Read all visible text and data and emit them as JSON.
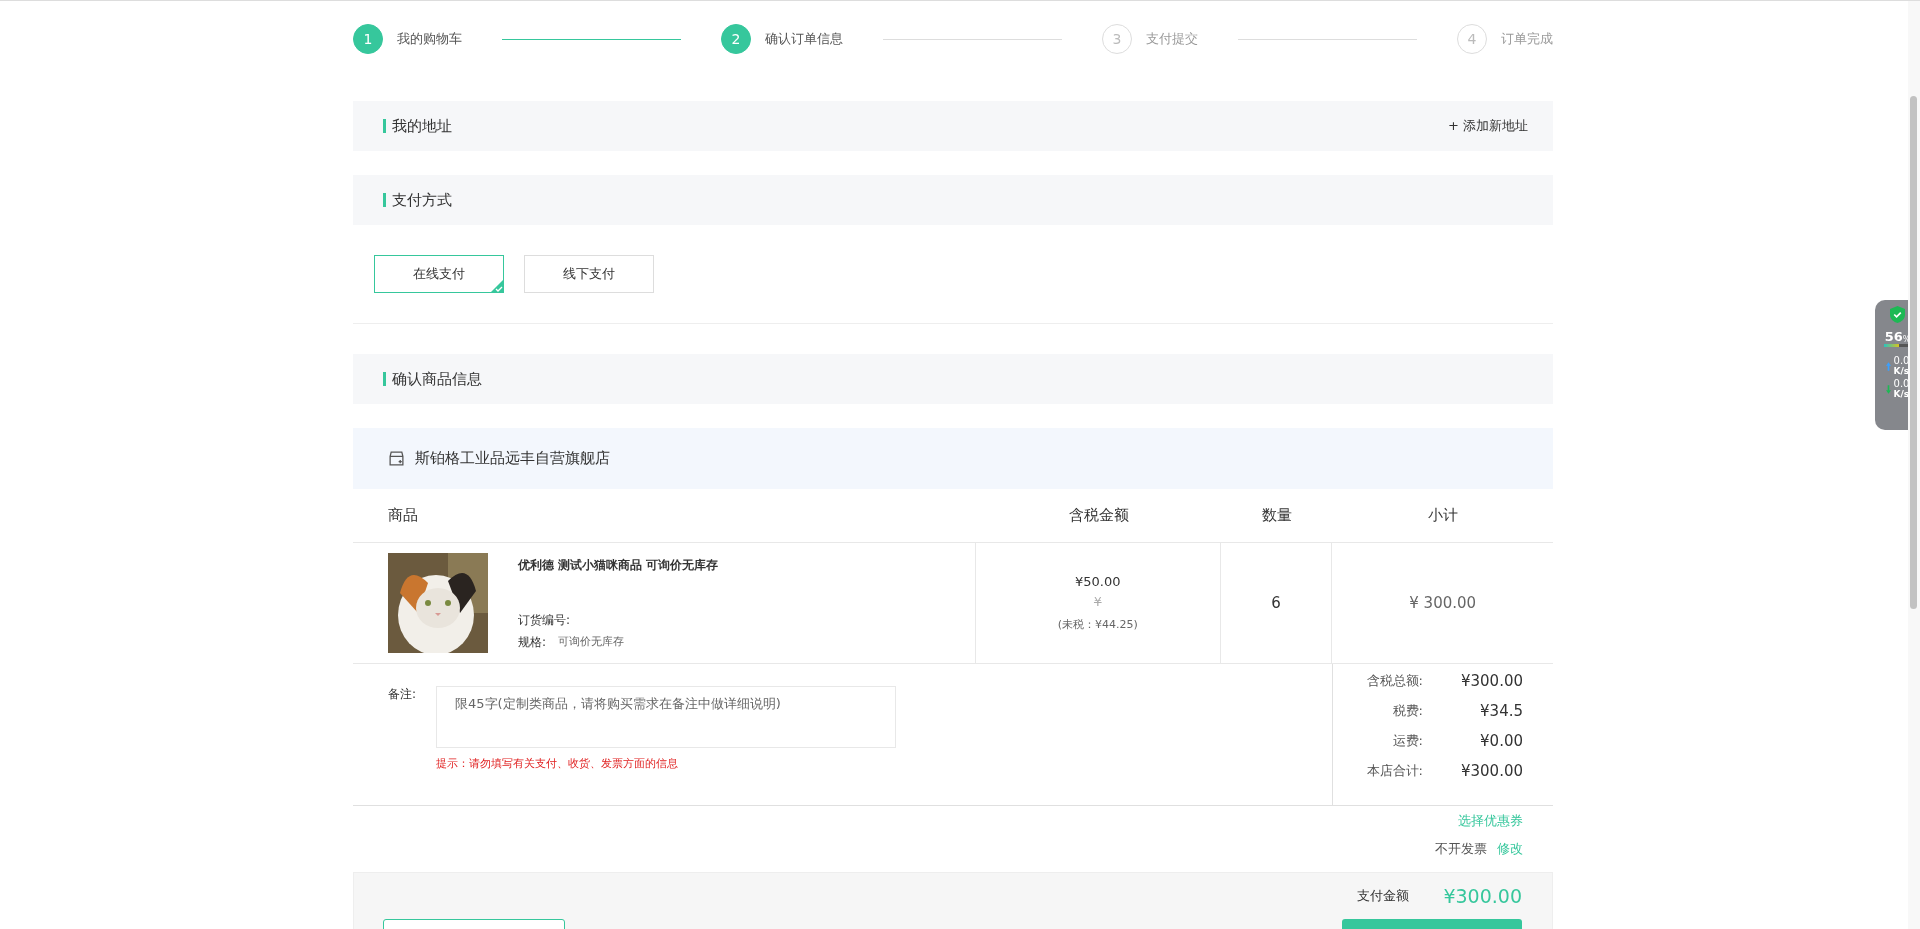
{
  "steps": [
    {
      "number": "1",
      "label": "我的购物车",
      "done": true
    },
    {
      "number": "2",
      "label": "确认订单信息",
      "done": true
    },
    {
      "number": "3",
      "label": "支付提交",
      "done": false
    },
    {
      "number": "4",
      "label": "订单完成",
      "done": false
    }
  ],
  "address": {
    "title": "我的地址",
    "add_link": "+ 添加新地址"
  },
  "payment": {
    "title": "支付方式",
    "options": [
      {
        "label": "在线支付",
        "selected": true
      },
      {
        "label": "线下支付",
        "selected": false
      }
    ]
  },
  "goods": {
    "title": "确认商品信息",
    "shop": "斯铂格工业品远丰自营旗舰店",
    "columns": [
      "商品",
      "含税金额",
      "数量",
      "小计"
    ],
    "items": [
      {
        "name": "优利德 测试小猫咪商品 可询价无库存",
        "order_no_label": "订货编号:",
        "spec_label": "规格:",
        "spec": "可询价无库存",
        "price": "¥50.00",
        "old_price": "¥",
        "pretax": "(未税：¥44.25)",
        "qty": "6",
        "subtotal": "¥ 300.00"
      }
    ],
    "remark": {
      "label": "备注:",
      "placeholder": "限45字(定制类商品，请将购买需求在备注中做详细说明)",
      "hint": "提示：请勿填写有关支付、收货、发票方面的信息"
    },
    "summary": [
      {
        "label": "含税总额:",
        "value": "¥300.00"
      },
      {
        "label": "税费:",
        "value": "¥34.5"
      },
      {
        "label": "运费:",
        "value": "¥0.00"
      },
      {
        "label": "本店合计:",
        "value": "¥300.00"
      }
    ],
    "coupon_link": "选择优惠券",
    "invoice": "不开发票",
    "invoice_edit": "修改"
  },
  "pay_total": {
    "label": "支付金额",
    "value": "¥300.00"
  },
  "monitor": {
    "percent": "56",
    "unit": "%",
    "up": "0.0",
    "up_unit": "K/s",
    "down": "0.0",
    "down_unit": "K/s",
    "level": 0.56
  }
}
